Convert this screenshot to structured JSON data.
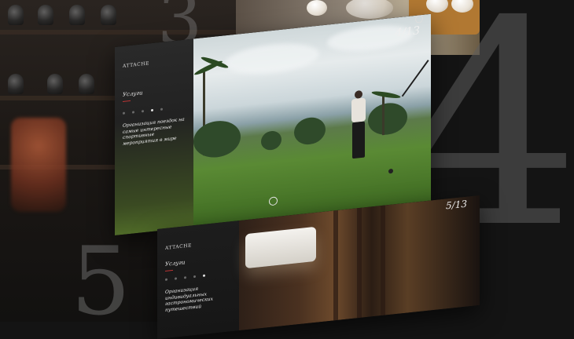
{
  "background": {
    "digits": [
      "3",
      "4",
      "5"
    ]
  },
  "slide_main": {
    "logo": "ATTACHE",
    "logo_sub": "",
    "section": "Услуги",
    "heading": "Организация поездок на самые интересные спортивные мероприятия в мире",
    "body": "",
    "counter": "4/13",
    "dots_total": 5,
    "dots_active": 3
  },
  "slide_bottom": {
    "logo": "ATTACHE",
    "section": "Услуги",
    "heading": "Организация индивидуальных гастрономических путешествий",
    "counter": "5/13"
  },
  "colors": {
    "accent": "#b33333",
    "text_light": "#f2f2f2",
    "text_muted": "#a9a9a9"
  }
}
